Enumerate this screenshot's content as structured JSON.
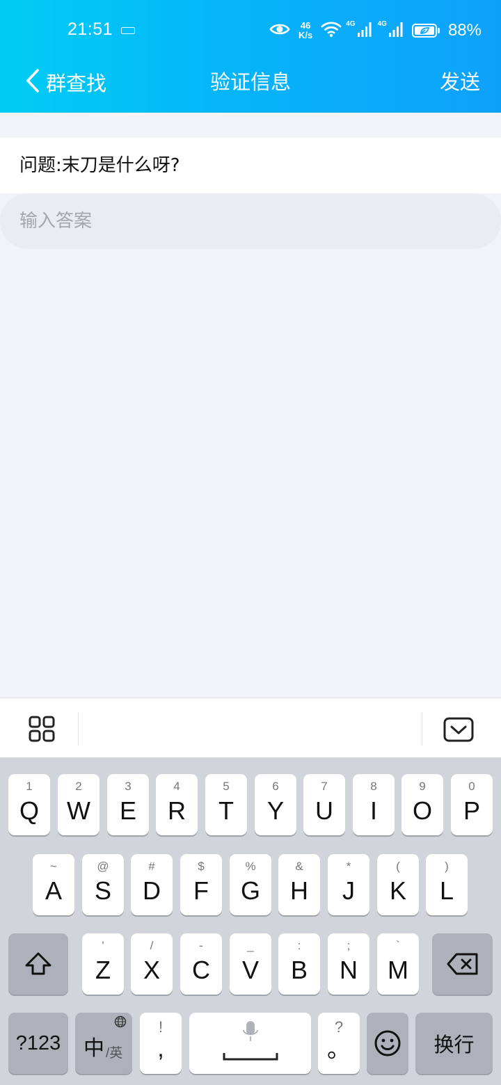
{
  "status_bar": {
    "time": "21:51",
    "net_speed_value": "46",
    "net_speed_unit": "K/s",
    "sim1_network": "4G",
    "sim2_network": "4G",
    "battery": "88%"
  },
  "nav": {
    "back_label": "群查找",
    "title": "验证信息",
    "send_label": "发送"
  },
  "question": "问题:末刀是什么呀?",
  "answer_input": {
    "placeholder": "输入答案",
    "value": ""
  },
  "keyboard": {
    "row1": [
      {
        "main": "Q",
        "hint": "1"
      },
      {
        "main": "W",
        "hint": "2"
      },
      {
        "main": "E",
        "hint": "3"
      },
      {
        "main": "R",
        "hint": "4"
      },
      {
        "main": "T",
        "hint": "5"
      },
      {
        "main": "Y",
        "hint": "6"
      },
      {
        "main": "U",
        "hint": "7"
      },
      {
        "main": "I",
        "hint": "8"
      },
      {
        "main": "O",
        "hint": "9"
      },
      {
        "main": "P",
        "hint": "0"
      }
    ],
    "row2": [
      {
        "main": "A",
        "hint": "~"
      },
      {
        "main": "S",
        "hint": "@"
      },
      {
        "main": "D",
        "hint": "#"
      },
      {
        "main": "F",
        "hint": "$"
      },
      {
        "main": "G",
        "hint": "%"
      },
      {
        "main": "H",
        "hint": "&"
      },
      {
        "main": "J",
        "hint": "*"
      },
      {
        "main": "K",
        "hint": "("
      },
      {
        "main": "L",
        "hint": ")"
      }
    ],
    "row3": [
      {
        "main": "Z",
        "hint": "'"
      },
      {
        "main": "X",
        "hint": "/"
      },
      {
        "main": "C",
        "hint": "-"
      },
      {
        "main": "V",
        "hint": "_"
      },
      {
        "main": "B",
        "hint": ":"
      },
      {
        "main": "N",
        "hint": ";"
      },
      {
        "main": "M",
        "hint": "`"
      }
    ],
    "sym_label": "?123",
    "lang_main": "中",
    "lang_sub": "/英",
    "punct_hint": "!",
    "punct_main": ",",
    "period_hint": "?",
    "period_main": "。",
    "enter_label": "换行"
  },
  "icons": {
    "back": "chevron-left-icon",
    "eye": "eye-icon",
    "wifi": "wifi-icon",
    "signal": "signal-icon",
    "battery": "battery-icon",
    "menu": "grid-icon",
    "hide": "keyboard-hide-icon",
    "shift": "shift-icon",
    "delete": "backspace-icon",
    "mic": "microphone-icon",
    "emoji": "emoji-icon",
    "globe": "globe-icon"
  },
  "colors": {
    "header_start": "#00cdf5",
    "header_end": "#0ea1fb",
    "page_bg": "#f2f3f7",
    "keyboard_bg": "#d1d4db"
  }
}
